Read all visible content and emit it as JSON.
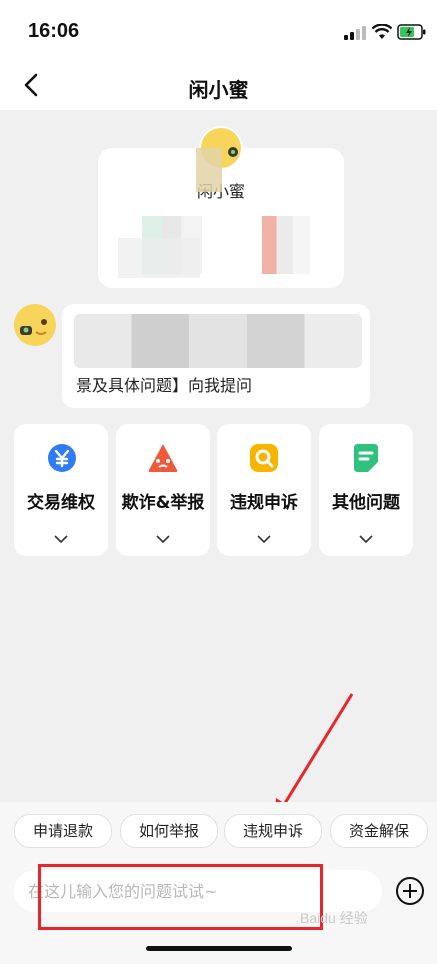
{
  "status_bar": {
    "time": "16:06"
  },
  "nav": {
    "title": "闲小蜜"
  },
  "bot_card": {
    "name": "闲小蜜"
  },
  "message": {
    "text_visible": "景及具体问题】向我提问"
  },
  "categories": [
    {
      "label": "交易维权",
      "icon": "yen-shield-icon",
      "color": "#2f7cf6"
    },
    {
      "label": "欺诈&举报",
      "icon": "warning-icon",
      "color": "#f05a3c"
    },
    {
      "label": "违规申诉",
      "icon": "search-icon",
      "color": "#f7b500"
    },
    {
      "label": "其他问题",
      "icon": "note-icon",
      "color": "#2ec27e"
    }
  ],
  "quick_chips": [
    {
      "label": "申请退款"
    },
    {
      "label": "如何举报"
    },
    {
      "label": "违规申诉"
    },
    {
      "label": "资金解保"
    }
  ],
  "input": {
    "placeholder": "在这儿输入您的问题试试~"
  },
  "watermark": "Baidu 经验",
  "colors": {
    "accent_red": "#e8252b",
    "bot_yellow": "#f7d55b"
  }
}
